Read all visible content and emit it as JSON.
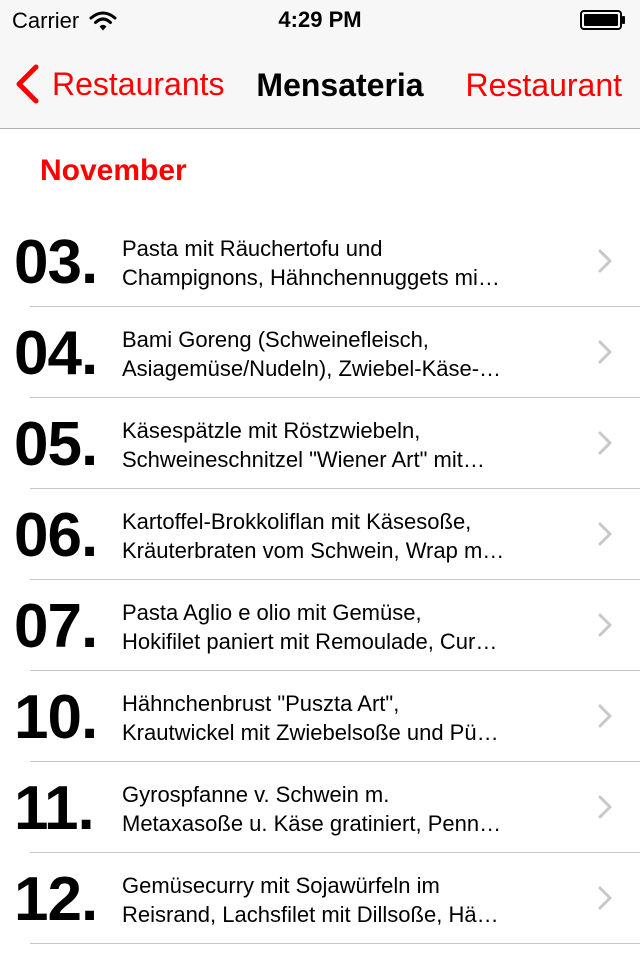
{
  "status_bar": {
    "carrier": "Carrier",
    "time": "4:29 PM"
  },
  "nav": {
    "back_label": "Restaurants",
    "title": "Mensateria",
    "right_label": "Restaurant"
  },
  "section": {
    "title": "November"
  },
  "items": [
    {
      "day": "03.",
      "line1": "Pasta mit Räuchertofu und",
      "line2": "Champignons, Hähnchennuggets mi…"
    },
    {
      "day": "04.",
      "line1": "Bami Goreng (Schweinefleisch,",
      "line2": "Asiagemüse/Nudeln), Zwiebel-Käse-…"
    },
    {
      "day": "05.",
      "line1": "Käsespätzle mit Röstzwiebeln,",
      "line2": "Schweineschnitzel \"Wiener Art\" mit…"
    },
    {
      "day": "06.",
      "line1": "Kartoffel-Brokkoliflan mit Käsesoße,",
      "line2": "Kräuterbraten vom Schwein, Wrap m…"
    },
    {
      "day": "07.",
      "line1": "Pasta Aglio e olio mit Gemüse,",
      "line2": "Hokifilet paniert mit Remoulade, Cur…"
    },
    {
      "day": "10.",
      "line1": "Hähnchenbrust \"Puszta Art\",",
      "line2": "Krautwickel mit Zwiebelsoße und Pü…"
    },
    {
      "day": "11.",
      "line1": "Gyrospfanne v. Schwein m.",
      "line2": "Metaxasoße u. Käse  gratiniert, Penn…"
    },
    {
      "day": "12.",
      "line1": "Gemüsecurry mit Sojawürfeln im",
      "line2": "Reisrand, Lachsfilet mit Dillsoße, Hä…"
    }
  ],
  "colors": {
    "accent": "#ff0000",
    "bar_bg": "#f7f7f7",
    "separator": "#c8c7cc",
    "chevron": "#c7c7cc"
  },
  "icons": {
    "wifi": "wifi-icon",
    "battery": "battery-icon",
    "back": "back-chevron-icon",
    "disclosure": "chevron-right-icon"
  }
}
